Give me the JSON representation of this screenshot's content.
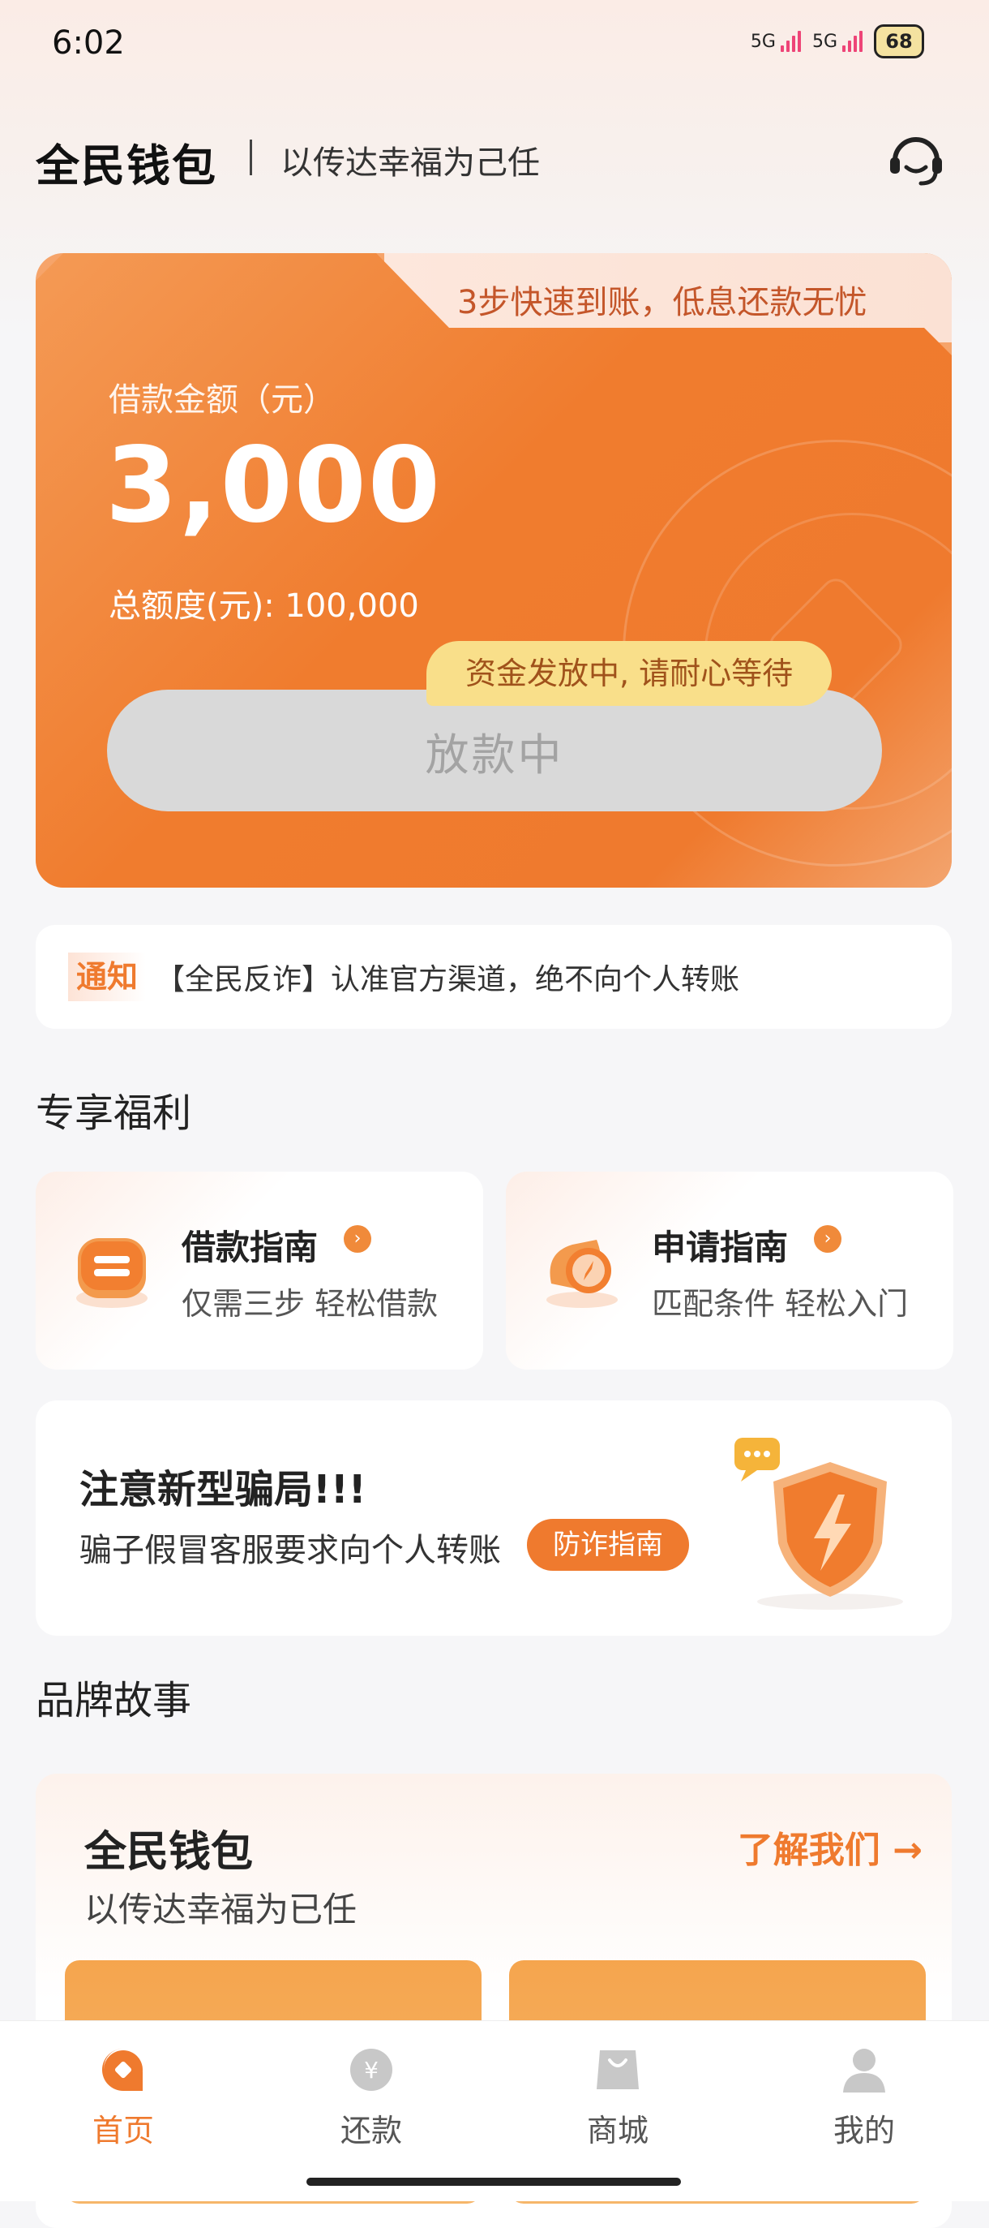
{
  "status_bar": {
    "time": "6:02",
    "signal1": "5G",
    "signal2": "5G",
    "battery": "68"
  },
  "header": {
    "brand": "全民钱包",
    "slogan": "以传达幸福为己任",
    "icon": "headset-icon"
  },
  "loan_card": {
    "tab_text": "3步快速到账，低息还款无忧",
    "amount_label": "借款金额（元）",
    "amount": "3,000",
    "total_label": "总额度(元): 100,000",
    "status_bubble": "资金发放中, 请耐心等待",
    "button_label": "放款中"
  },
  "notice": {
    "tag": "通知",
    "text": "【全民反诈】认准官方渠道，绝不向个人转账"
  },
  "benefits": {
    "section_title": "专享福利",
    "items": [
      {
        "title": "借款指南",
        "sub": "仅需三步 轻松借款",
        "icon": "loan-guide-icon"
      },
      {
        "title": "申请指南",
        "sub": "匹配条件 轻松入门",
        "icon": "apply-guide-icon"
      }
    ]
  },
  "scam_card": {
    "title": "注意新型骗局!!!",
    "sub": "骗子假冒客服要求向个人转账",
    "button": "防诈指南",
    "icon": "shield-icon"
  },
  "story": {
    "section_title": "品牌故事",
    "title": "全民钱包",
    "sub": "以传达幸福为已任",
    "more": "了解我们 →"
  },
  "tabbar": {
    "items": [
      {
        "label": "首页",
        "icon": "home-icon",
        "active": true
      },
      {
        "label": "还款",
        "icon": "repay-icon",
        "active": false
      },
      {
        "label": "商城",
        "icon": "shop-icon",
        "active": false
      },
      {
        "label": "我的",
        "icon": "profile-icon",
        "active": false
      }
    ]
  },
  "colors": {
    "accent": "#ef7a2e",
    "background": "#f6f6f8",
    "button_disabled": "#d9d9d9",
    "bubble": "#f9df8a"
  }
}
